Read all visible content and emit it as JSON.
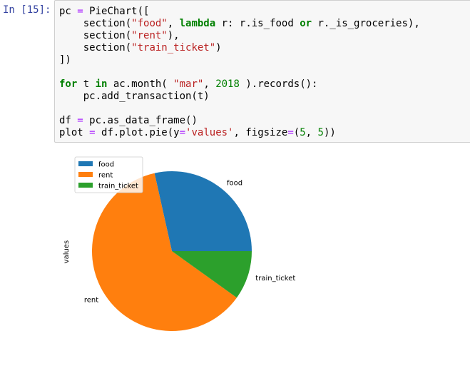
{
  "cell": {
    "prompt": "In [15]:",
    "code_lines": [
      [
        [
          "t",
          "pc "
        ],
        [
          "op",
          "="
        ],
        [
          "t",
          " PieChart(["
        ]
      ],
      [
        [
          "t",
          "    section("
        ],
        [
          "str",
          "\"food\""
        ],
        [
          "t",
          ", "
        ],
        [
          "kw",
          "lambda"
        ],
        [
          "t",
          " r: r.is_food "
        ],
        [
          "kw",
          "or"
        ],
        [
          "t",
          " r._is_groceries),"
        ]
      ],
      [
        [
          "t",
          "    section("
        ],
        [
          "str",
          "\"rent\""
        ],
        [
          "t",
          "),"
        ]
      ],
      [
        [
          "t",
          "    section("
        ],
        [
          "str",
          "\"train_ticket\""
        ],
        [
          "t",
          ")"
        ]
      ],
      [
        [
          "t",
          "])"
        ]
      ],
      [
        [
          "t",
          ""
        ]
      ],
      [
        [
          "kw",
          "for"
        ],
        [
          "t",
          " t "
        ],
        [
          "kw",
          "in"
        ],
        [
          "t",
          " ac.month( "
        ],
        [
          "str",
          "\"mar\""
        ],
        [
          "t",
          ", "
        ],
        [
          "num",
          "2018"
        ],
        [
          "t",
          " ).records():"
        ]
      ],
      [
        [
          "t",
          "    pc.add_transaction(t)"
        ]
      ],
      [
        [
          "t",
          ""
        ]
      ],
      [
        [
          "t",
          "df "
        ],
        [
          "op",
          "="
        ],
        [
          "t",
          " pc.as_data_frame()"
        ]
      ],
      [
        [
          "t",
          "plot "
        ],
        [
          "op",
          "="
        ],
        [
          "t",
          " df.plot.pie(y"
        ],
        [
          "op",
          "="
        ],
        [
          "str",
          "'values'"
        ],
        [
          "t",
          ", figsize"
        ],
        [
          "op",
          "="
        ],
        [
          "t",
          "("
        ],
        [
          "num",
          "5"
        ],
        [
          "t",
          ", "
        ],
        [
          "num",
          "5"
        ],
        [
          "t",
          "))"
        ]
      ]
    ]
  },
  "chart_data": {
    "type": "pie",
    "ylabel": "values",
    "categories": [
      "food",
      "rent",
      "train_ticket"
    ],
    "values": [
      28.5,
      61.6,
      9.9
    ],
    "colors": [
      "#1f77b4",
      "#ff7f0e",
      "#2ca02c"
    ],
    "start_angle_deg": 0,
    "direction": "counterclockwise",
    "legend": {
      "placement": "upper-left",
      "entries": [
        "food",
        "rent",
        "train_ticket"
      ]
    }
  }
}
